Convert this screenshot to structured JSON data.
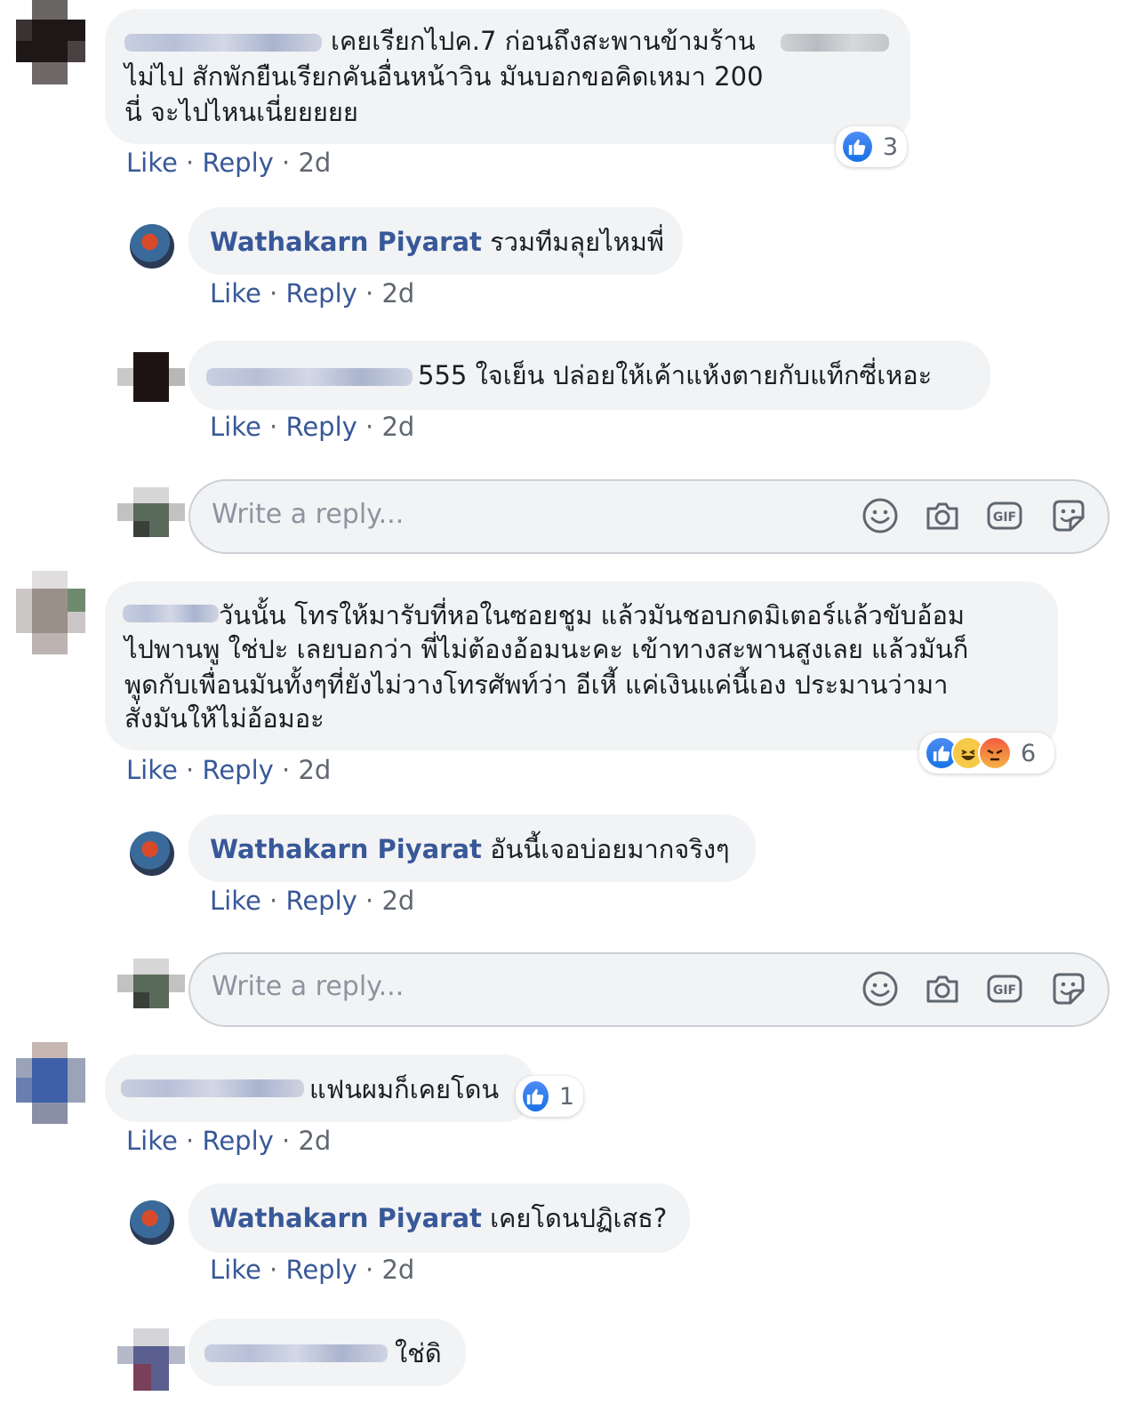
{
  "comments": [
    {
      "id": "c1",
      "text_lines": [
        "เคยเรียกไปค.7 ก่อนถึงสะพานข้ามร้าน",
        "ไม่ไป สักพักยืนเรียกคันอื่นหน้าวิน มันบอกขอคิดเหมา 200",
        "นี่ จะไปไหนเนี่ยยยยย"
      ],
      "reaction_count": "3",
      "actions": {
        "like": "Like",
        "reply": "Reply",
        "time": "2d"
      },
      "replies": [
        {
          "author": "Wathakarn Piyarat",
          "text": "รวมทีมลุยไหมพี่",
          "actions": {
            "like": "Like",
            "reply": "Reply",
            "time": "2d"
          }
        },
        {
          "author": "",
          "text": "555 ใจเย็น ปล่อยให้เค้าแห้งตายกับแท็กซี่เหอะ",
          "actions": {
            "like": "Like",
            "reply": "Reply",
            "time": "2d"
          }
        }
      ]
    },
    {
      "id": "c2",
      "text_lines": [
        "วันนั้น โทรให้มารับที่หอในซอยชูม แล้วมันชอบกดมิเตอร์แล้วขับอ้อม",
        "ไปพานพู ใช่ปะ  เลยบอกว่า พี่ไม่ต้องอ้อมนะคะ เข้าทางสะพานสูงเลย แล้วมันก็",
        "พูดกับเพื่อนมันทั้งๆที่ยังไม่วางโทรศัพท์ว่า อีเหี้ แค่เงินแค่นี้เอง ประมานว่ามา",
        "สั่งมันให้ไม่อ้อมอะ"
      ],
      "reaction_count": "6",
      "actions": {
        "like": "Like",
        "reply": "Reply",
        "time": "2d"
      },
      "replies": [
        {
          "author": "Wathakarn Piyarat",
          "text": "อันนี้เจอบ่อยมากจริงๆ",
          "actions": {
            "like": "Like",
            "reply": "Reply",
            "time": "2d"
          }
        }
      ]
    },
    {
      "id": "c3",
      "text_lines": [
        "แฟนผมก็เคยโดน"
      ],
      "reaction_count": "1",
      "actions": {
        "like": "Like",
        "reply": "Reply",
        "time": "2d"
      },
      "replies": [
        {
          "author": "Wathakarn Piyarat",
          "text": "เคยโดนปฏิเสธ?",
          "actions": {
            "like": "Like",
            "reply": "Reply",
            "time": "2d"
          }
        },
        {
          "author": "",
          "text": "ใช่ดิ"
        }
      ]
    }
  ],
  "reply_box": {
    "placeholder": "Write a reply...",
    "gif_label": "GIF"
  },
  "colors": {
    "link": "#385898",
    "bubble": "#f2f3f5",
    "like": "#1771e6"
  }
}
